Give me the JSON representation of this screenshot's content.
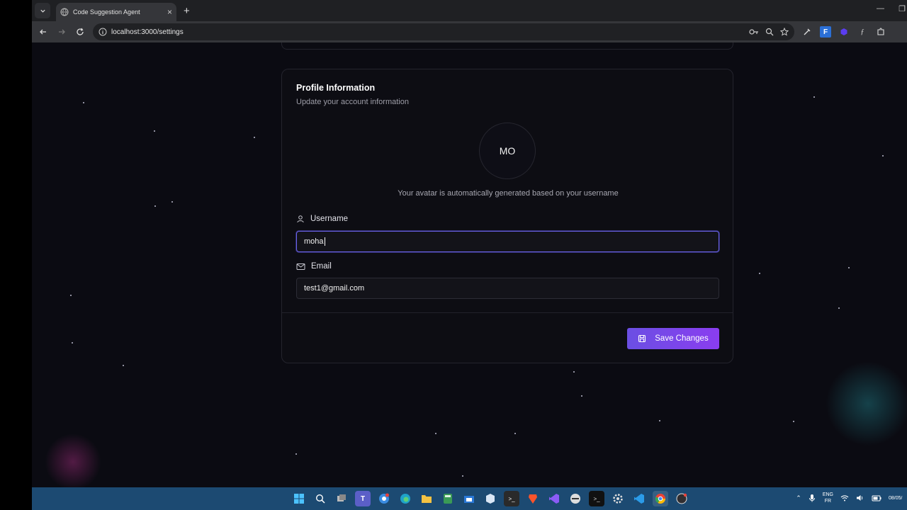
{
  "browser": {
    "tab_title": "Code Suggestion Agent",
    "url": "localhost:3000/settings"
  },
  "profile": {
    "title": "Profile Information",
    "subtitle": "Update your account information",
    "avatar_initials": "MO",
    "avatar_note": "Your avatar is automatically generated based on your username",
    "username_label": "Username",
    "username_value": "moha",
    "email_label": "Email",
    "email_value": "test1@gmail.com",
    "save_label": "Save Changes"
  },
  "taskbar": {
    "lang_top": "ENG",
    "lang_bottom": "FR",
    "date": "08/05/"
  },
  "colors": {
    "accent_start": "#6b4fe3",
    "accent_end": "#8a3df0",
    "page_bg": "#0b0b12",
    "focus_border": "#6b63e8"
  }
}
